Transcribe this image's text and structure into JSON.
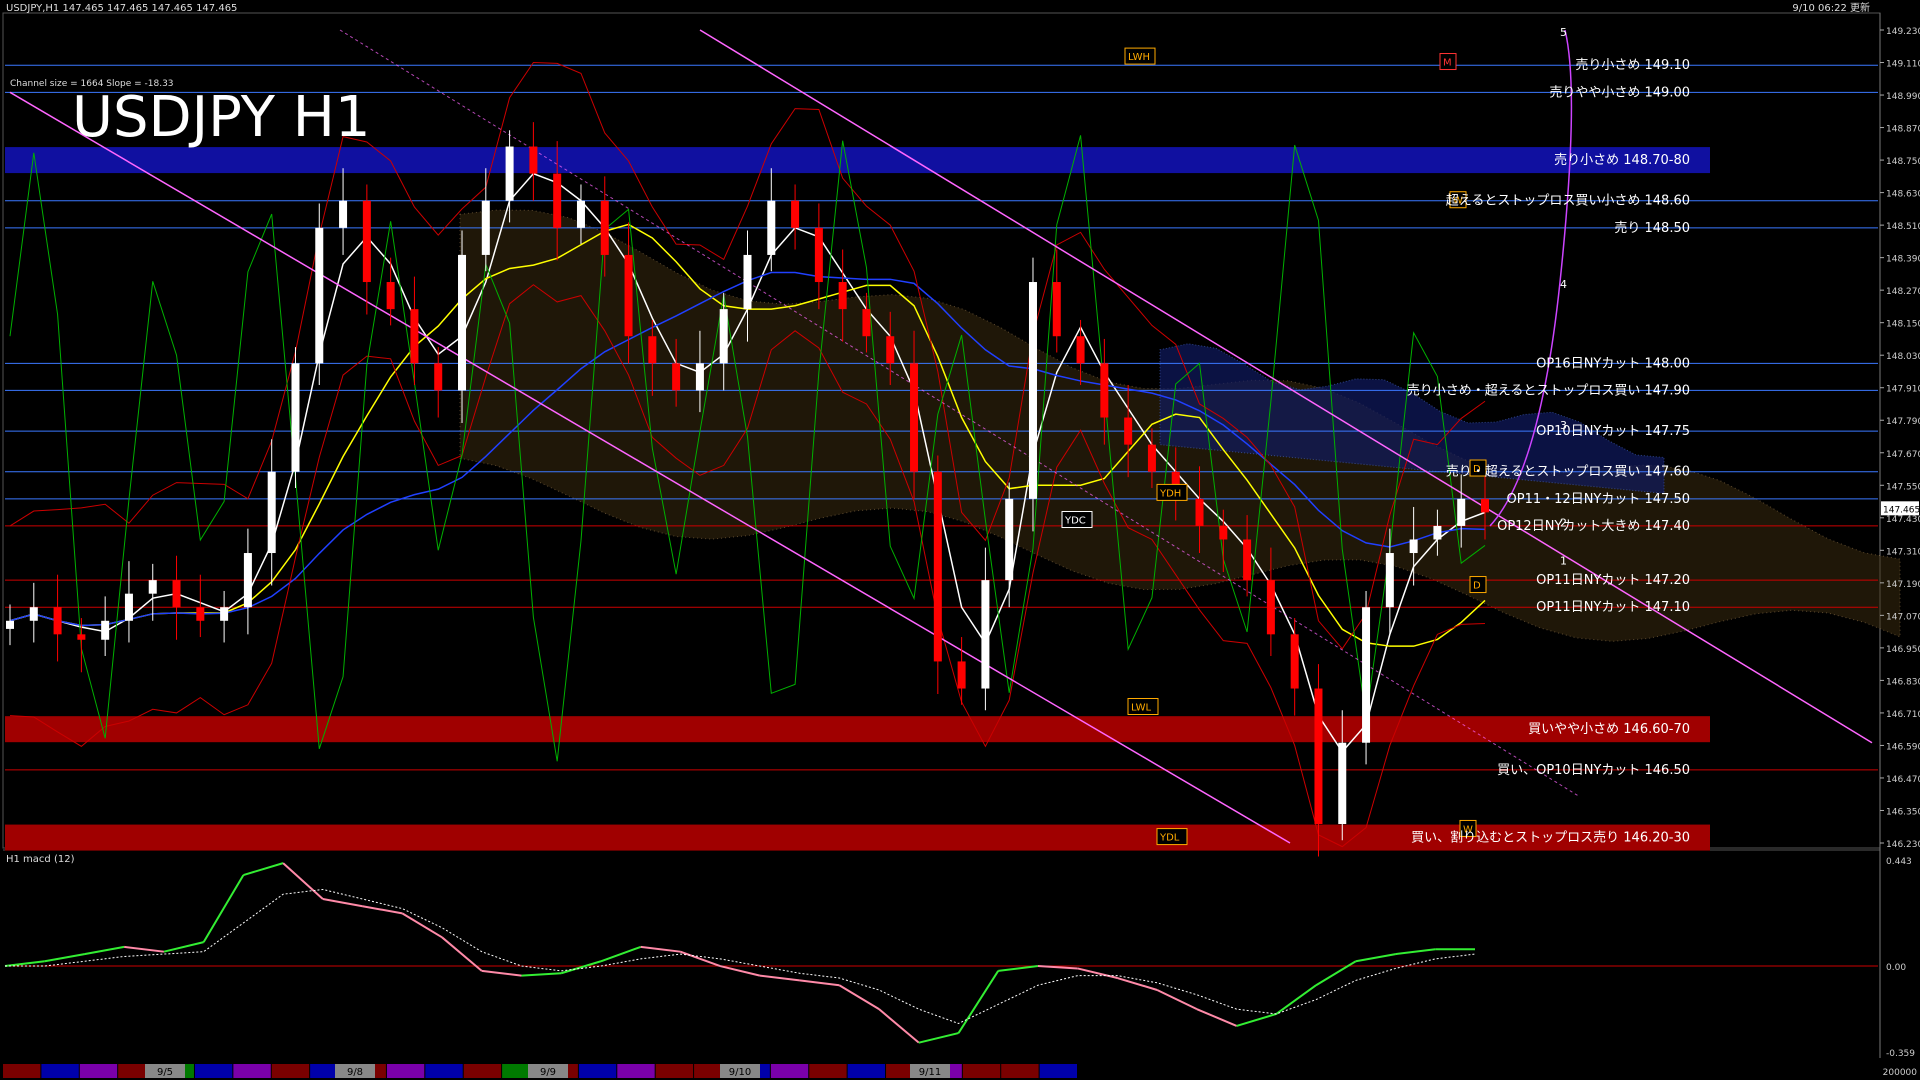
{
  "header": {
    "symbol_info": "USDJPY,H1  147.465 147.465 147.465 147.465",
    "timestamp": "9/10 06:22 更新",
    "channel_info": "Channel size = 1664 Slope = -18.33",
    "big_title": "USDJPY H1"
  },
  "colors": {
    "background": "#000000",
    "bull_candle": "#ffffff",
    "bear_candle": "#ff0000",
    "level_line_blue": "#3b78ff",
    "level_line_red": "#cc0000",
    "band_blue": "#1010a0",
    "band_red": "#a00000",
    "channel": "#ff66ff",
    "ma_white": "#ffffff",
    "ma_yellow": "#ffff00",
    "ma_blue": "#2040ff",
    "bollinger_red": "#cc0000",
    "oscillator_green": "#00b000",
    "macd_green": "#33ee33",
    "macd_pink": "#ff8aa8"
  },
  "chart_data": [
    {
      "type": "candlestick",
      "title": "USDJPY H1",
      "ylim": [
        146.23,
        149.23
      ],
      "y_ticks": [
        "149.230",
        "149.110",
        "148.990",
        "148.870",
        "148.750",
        "148.630",
        "148.510",
        "148.390",
        "148.270",
        "148.150",
        "148.030",
        "147.910",
        "147.790",
        "147.670",
        "147.550",
        "147.430",
        "147.310",
        "147.190",
        "147.070",
        "146.950",
        "146.830",
        "146.710",
        "146.590",
        "146.470",
        "146.350",
        "146.230"
      ],
      "current_price": "147.465",
      "x_labels": [
        "9/5",
        "9/8",
        "9/9",
        "9/10",
        "9/11"
      ],
      "price_close_approx": [
        147.05,
        147.1,
        147.0,
        146.98,
        147.05,
        147.15,
        147.2,
        147.1,
        147.05,
        147.1,
        147.3,
        147.6,
        148.0,
        148.5,
        148.6,
        148.3,
        148.2,
        148.0,
        147.9,
        148.4,
        148.6,
        148.8,
        148.7,
        148.5,
        148.6,
        148.4,
        148.1,
        148.0,
        147.9,
        148.0,
        148.2,
        148.4,
        148.6,
        148.5,
        148.3,
        148.2,
        148.1,
        148.0,
        147.6,
        146.9,
        146.8,
        147.2,
        147.5,
        148.3,
        148.1,
        148.0,
        147.8,
        147.7,
        147.6,
        147.5,
        147.4,
        147.35,
        147.2,
        147.0,
        146.8,
        146.3,
        146.6,
        147.1,
        147.3,
        147.35,
        147.4,
        147.5,
        147.45
      ],
      "levels": [
        {
          "price": 149.1,
          "label": "売り小さめ 149.10",
          "color": "blue"
        },
        {
          "price": 149.0,
          "label": "売りやや小さめ 149.00",
          "color": "blue"
        },
        {
          "price": 148.75,
          "label": "売り小さめ 148.70-80",
          "color": "blue",
          "band": true
        },
        {
          "price": 148.6,
          "label": "超えるとストップロス買い小さめ 148.60",
          "color": "blue"
        },
        {
          "price": 148.5,
          "label": "売り 148.50",
          "color": "blue"
        },
        {
          "price": 148.0,
          "label": "OP16日NYカット 148.00",
          "color": "blue"
        },
        {
          "price": 147.9,
          "label": "売り小さめ・超えるとストップロス買い 147.90",
          "color": "blue"
        },
        {
          "price": 147.75,
          "label": "OP10日NYカット 147.75",
          "color": "blue"
        },
        {
          "price": 147.6,
          "label": "売り・超えるとストップロス買い 147.60",
          "color": "blue"
        },
        {
          "price": 147.5,
          "label": "OP11・12日NYカット 147.50",
          "color": "blue"
        },
        {
          "price": 147.4,
          "label": "OP12日NYカット大きめ 147.40",
          "color": "red"
        },
        {
          "price": 147.2,
          "label": "OP11日NYカット 147.20",
          "color": "red"
        },
        {
          "price": 147.1,
          "label": "OP11日NYカット 147.10",
          "color": "red"
        },
        {
          "price": 146.65,
          "label": "買いやや小さめ 146.60-70",
          "color": "red",
          "band": true
        },
        {
          "price": 146.5,
          "label": "買い、OP10日NYカット 146.50",
          "color": "red"
        },
        {
          "price": 146.25,
          "label": "買い、割り込むとストップロス売り 146.20-30",
          "color": "red",
          "band": true
        }
      ],
      "markers": [
        "LWH",
        "LWL",
        "YDH",
        "YDC",
        "YDL",
        "D",
        "D",
        "W",
        "W",
        "M"
      ],
      "wave_labels": [
        "5",
        "4",
        "3",
        "2",
        "1"
      ]
    },
    {
      "type": "line",
      "title": "H1  macd (12)",
      "ylim": [
        -0.359,
        0.443
      ],
      "y_ticks": [
        "0.443",
        "0.00",
        "-0.359"
      ],
      "series": [
        {
          "name": "macd",
          "values": [
            0.0,
            0.02,
            0.05,
            0.08,
            0.06,
            0.1,
            0.38,
            0.43,
            0.28,
            0.25,
            0.22,
            0.12,
            -0.02,
            -0.04,
            -0.03,
            0.02,
            0.08,
            0.06,
            0.0,
            -0.04,
            -0.06,
            -0.08,
            -0.18,
            -0.32,
            -0.28,
            -0.02,
            0.0,
            -0.01,
            -0.05,
            -0.1,
            -0.18,
            -0.25,
            -0.2,
            -0.08,
            0.02,
            0.05,
            0.07,
            0.07
          ]
        },
        {
          "name": "signal",
          "values": [
            0.0,
            0.0,
            0.02,
            0.04,
            0.05,
            0.06,
            0.18,
            0.3,
            0.32,
            0.28,
            0.24,
            0.16,
            0.06,
            0.0,
            -0.02,
            0.0,
            0.03,
            0.05,
            0.03,
            0.0,
            -0.03,
            -0.05,
            -0.1,
            -0.18,
            -0.24,
            -0.16,
            -0.08,
            -0.04,
            -0.04,
            -0.07,
            -0.12,
            -0.18,
            -0.2,
            -0.14,
            -0.06,
            -0.01,
            0.03,
            0.05
          ]
        }
      ]
    }
  ],
  "bottom_bar": {
    "right_value": "200000"
  }
}
